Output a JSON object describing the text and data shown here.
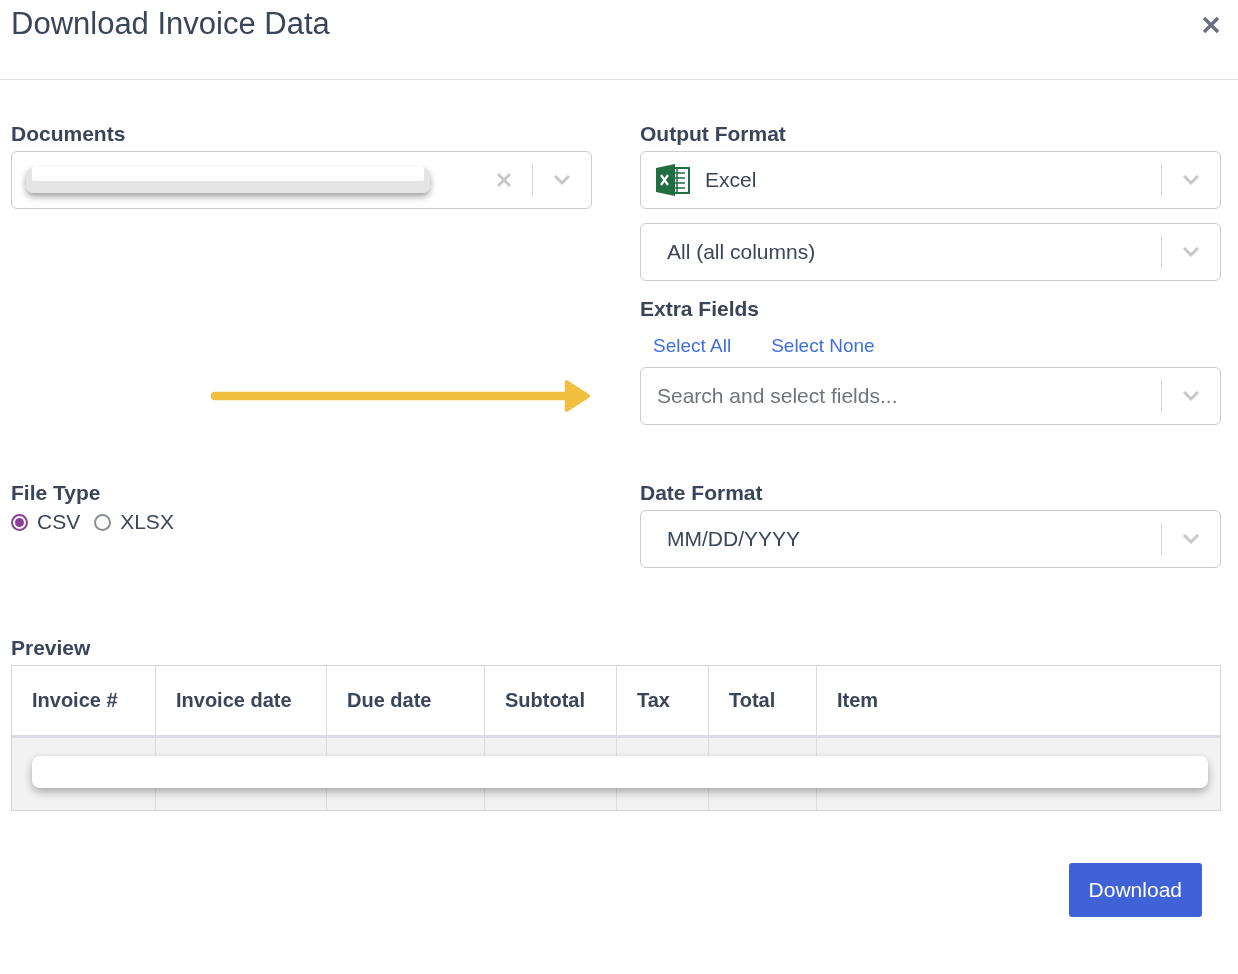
{
  "dialog": {
    "title": "Download Invoice Data"
  },
  "documents": {
    "label": "Documents",
    "value": {
      "kind": "redacted"
    },
    "clearable": true
  },
  "output_format": {
    "label": "Output Format",
    "value": "Excel"
  },
  "columns_select": {
    "value": "All (all columns)"
  },
  "extra_fields": {
    "label": "Extra Fields",
    "links": [
      "Select All",
      "Select None"
    ],
    "placeholder": "Search and select fields..."
  },
  "file_type": {
    "label": "File Type",
    "options": [
      {
        "label": "CSV",
        "selected": true
      },
      {
        "label": "XLSX",
        "selected": false
      }
    ]
  },
  "date_format": {
    "label": "Date Format",
    "value": "MM/DD/YYYY"
  },
  "preview": {
    "label": "Preview",
    "columns": [
      "Invoice #",
      "Invoice date",
      "Due date",
      "Subtotal",
      "Tax",
      "Total",
      "Item"
    ],
    "rows": [
      {
        "kind": "redacted"
      }
    ]
  },
  "buttons": [
    "Download"
  ]
}
